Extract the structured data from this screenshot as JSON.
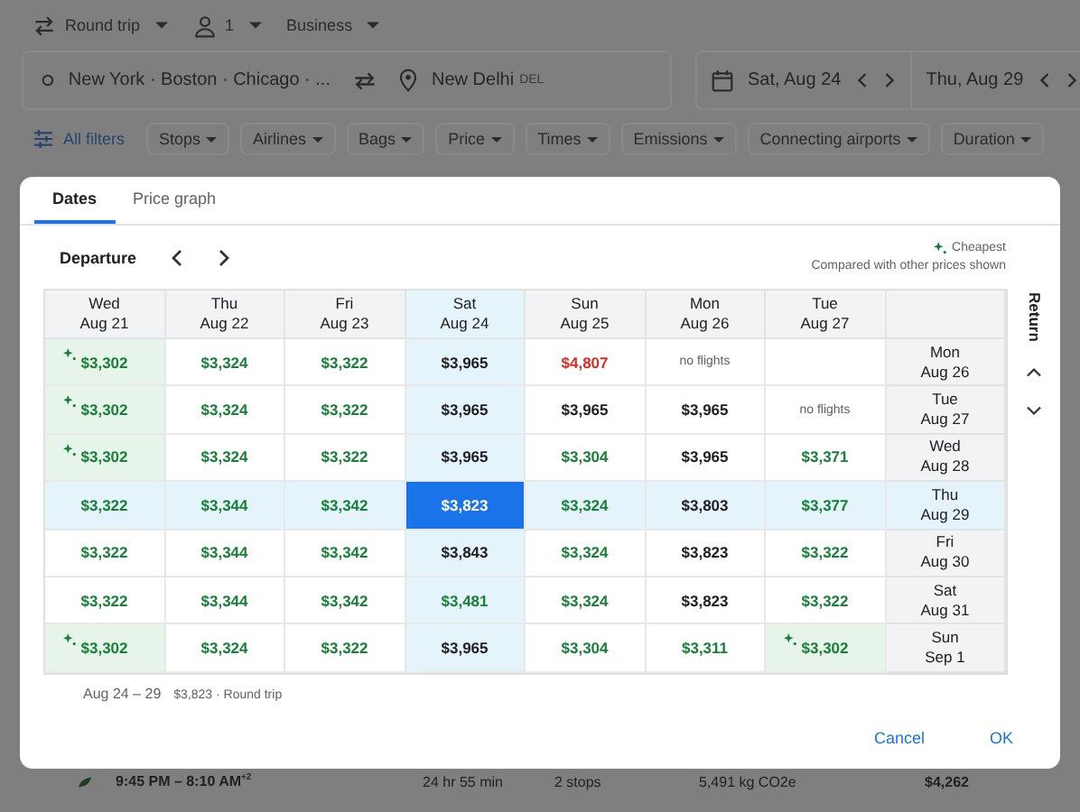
{
  "trip_options": [
    {
      "kind": "trip",
      "label": "Round trip"
    },
    {
      "kind": "passengers",
      "label": "1"
    },
    {
      "kind": "cabin",
      "label": "Business"
    }
  ],
  "search": {
    "origin": "New York · Boston · Chicago · ...",
    "destination": "New Delhi",
    "destination_code": "DEL",
    "departure_date": "Sat, Aug 24",
    "return_date": "Thu, Aug 29"
  },
  "filters": {
    "all_filters": "All filters",
    "chips": [
      "Stops",
      "Airlines",
      "Bags",
      "Price",
      "Times",
      "Emissions",
      "Connecting airports",
      "Duration"
    ]
  },
  "dialog": {
    "tabs": [
      {
        "label": "Dates",
        "selected": true
      },
      {
        "label": "Price graph",
        "selected": false
      }
    ],
    "departure_label": "Departure",
    "legend": "Cheapest",
    "legend_note": "Compared with other prices shown",
    "return_label": "Return",
    "columns": [
      {
        "day": "Wed",
        "date": "Aug 21",
        "selected": false
      },
      {
        "day": "Thu",
        "date": "Aug 22",
        "selected": false
      },
      {
        "day": "Fri",
        "date": "Aug 23",
        "selected": false
      },
      {
        "day": "Sat",
        "date": "Aug 24",
        "selected": true
      },
      {
        "day": "Sun",
        "date": "Aug 25",
        "selected": false
      },
      {
        "day": "Mon",
        "date": "Aug 26",
        "selected": false
      },
      {
        "day": "Tue",
        "date": "Aug 27",
        "selected": false
      }
    ],
    "rows": [
      {
        "day": "Mon",
        "date": "Aug 26",
        "selected": false,
        "cells": [
          {
            "kind": "price",
            "price": "$3,302",
            "color": "#188038",
            "cheapest": true,
            "selected": false
          },
          {
            "kind": "price",
            "price": "$3,324",
            "color": "#188038",
            "cheapest": false,
            "selected": false
          },
          {
            "kind": "price",
            "price": "$3,322",
            "color": "#188038",
            "cheapest": false,
            "selected": false
          },
          {
            "kind": "price",
            "price": "$3,965",
            "color": "#202124",
            "cheapest": false,
            "selected": false
          },
          {
            "kind": "price",
            "price": "$4,807",
            "color": "#d93025",
            "cheapest": false,
            "selected": false
          },
          {
            "kind": "none",
            "text": "no flights"
          },
          {
            "kind": "empty"
          }
        ]
      },
      {
        "day": "Tue",
        "date": "Aug 27",
        "selected": false,
        "cells": [
          {
            "kind": "price",
            "price": "$3,302",
            "color": "#188038",
            "cheapest": true,
            "selected": false
          },
          {
            "kind": "price",
            "price": "$3,324",
            "color": "#188038",
            "cheapest": false,
            "selected": false
          },
          {
            "kind": "price",
            "price": "$3,322",
            "color": "#188038",
            "cheapest": false,
            "selected": false
          },
          {
            "kind": "price",
            "price": "$3,965",
            "color": "#202124",
            "cheapest": false,
            "selected": false
          },
          {
            "kind": "price",
            "price": "$3,965",
            "color": "#202124",
            "cheapest": false,
            "selected": false
          },
          {
            "kind": "price",
            "price": "$3,965",
            "color": "#202124",
            "cheapest": false,
            "selected": false
          },
          {
            "kind": "none",
            "text": "no flights"
          }
        ]
      },
      {
        "day": "Wed",
        "date": "Aug 28",
        "selected": false,
        "cells": [
          {
            "kind": "price",
            "price": "$3,302",
            "color": "#188038",
            "cheapest": true,
            "selected": false
          },
          {
            "kind": "price",
            "price": "$3,324",
            "color": "#188038",
            "cheapest": false,
            "selected": false
          },
          {
            "kind": "price",
            "price": "$3,322",
            "color": "#188038",
            "cheapest": false,
            "selected": false
          },
          {
            "kind": "price",
            "price": "$3,965",
            "color": "#202124",
            "cheapest": false,
            "selected": false
          },
          {
            "kind": "price",
            "price": "$3,304",
            "color": "#188038",
            "cheapest": false,
            "selected": false
          },
          {
            "kind": "price",
            "price": "$3,965",
            "color": "#202124",
            "cheapest": false,
            "selected": false
          },
          {
            "kind": "price",
            "price": "$3,371",
            "color": "#188038",
            "cheapest": false,
            "selected": false
          }
        ]
      },
      {
        "day": "Thu",
        "date": "Aug 29",
        "selected": true,
        "cells": [
          {
            "kind": "price",
            "price": "$3,322",
            "color": "#188038",
            "cheapest": false,
            "selected": false
          },
          {
            "kind": "price",
            "price": "$3,344",
            "color": "#188038",
            "cheapest": false,
            "selected": false
          },
          {
            "kind": "price",
            "price": "$3,342",
            "color": "#188038",
            "cheapest": false,
            "selected": false
          },
          {
            "kind": "price",
            "price": "$3,823",
            "color": "#ffffff",
            "cheapest": false,
            "selected": true
          },
          {
            "kind": "price",
            "price": "$3,324",
            "color": "#188038",
            "cheapest": false,
            "selected": false
          },
          {
            "kind": "price",
            "price": "$3,803",
            "color": "#202124",
            "cheapest": false,
            "selected": false
          },
          {
            "kind": "price",
            "price": "$3,377",
            "color": "#188038",
            "cheapest": false,
            "selected": false
          }
        ]
      },
      {
        "day": "Fri",
        "date": "Aug 30",
        "selected": false,
        "cells": [
          {
            "kind": "price",
            "price": "$3,322",
            "color": "#188038",
            "cheapest": false,
            "selected": false
          },
          {
            "kind": "price",
            "price": "$3,344",
            "color": "#188038",
            "cheapest": false,
            "selected": false
          },
          {
            "kind": "price",
            "price": "$3,342",
            "color": "#188038",
            "cheapest": false,
            "selected": false
          },
          {
            "kind": "price",
            "price": "$3,843",
            "color": "#202124",
            "cheapest": false,
            "selected": false
          },
          {
            "kind": "price",
            "price": "$3,324",
            "color": "#188038",
            "cheapest": false,
            "selected": false
          },
          {
            "kind": "price",
            "price": "$3,823",
            "color": "#202124",
            "cheapest": false,
            "selected": false
          },
          {
            "kind": "price",
            "price": "$3,322",
            "color": "#188038",
            "cheapest": false,
            "selected": false
          }
        ]
      },
      {
        "day": "Sat",
        "date": "Aug 31",
        "selected": false,
        "cells": [
          {
            "kind": "price",
            "price": "$3,322",
            "color": "#188038",
            "cheapest": false,
            "selected": false
          },
          {
            "kind": "price",
            "price": "$3,344",
            "color": "#188038",
            "cheapest": false,
            "selected": false
          },
          {
            "kind": "price",
            "price": "$3,342",
            "color": "#188038",
            "cheapest": false,
            "selected": false
          },
          {
            "kind": "price",
            "price": "$3,481",
            "color": "#188038",
            "cheapest": false,
            "selected": false
          },
          {
            "kind": "price",
            "price": "$3,324",
            "color": "#188038",
            "cheapest": false,
            "selected": false
          },
          {
            "kind": "price",
            "price": "$3,823",
            "color": "#202124",
            "cheapest": false,
            "selected": false
          },
          {
            "kind": "price",
            "price": "$3,322",
            "color": "#188038",
            "cheapest": false,
            "selected": false
          }
        ]
      },
      {
        "day": "Sun",
        "date": "Sep 1",
        "selected": false,
        "cells": [
          {
            "kind": "price",
            "price": "$3,302",
            "color": "#188038",
            "cheapest": true,
            "selected": false
          },
          {
            "kind": "price",
            "price": "$3,324",
            "color": "#188038",
            "cheapest": false,
            "selected": false
          },
          {
            "kind": "price",
            "price": "$3,322",
            "color": "#188038",
            "cheapest": false,
            "selected": false
          },
          {
            "kind": "price",
            "price": "$3,965",
            "color": "#202124",
            "cheapest": false,
            "selected": false
          },
          {
            "kind": "price",
            "price": "$3,304",
            "color": "#188038",
            "cheapest": false,
            "selected": false
          },
          {
            "kind": "price",
            "price": "$3,311",
            "color": "#188038",
            "cheapest": false,
            "selected": false
          },
          {
            "kind": "price",
            "price": "$3,302",
            "color": "#188038",
            "cheapest": true,
            "selected": false
          }
        ]
      }
    ],
    "summary_dates": "Aug 24 – 29",
    "summary_price": "$3,823 · Round trip",
    "buttons": [
      "Cancel",
      "OK"
    ]
  },
  "result_row": {
    "times": "9:45 PM – 8:10 AM",
    "times_mark": "+2",
    "duration": "24 hr 55 min",
    "stops": "2 stops",
    "emissions": "5,491 kg CO2e",
    "price": "$4,262"
  }
}
